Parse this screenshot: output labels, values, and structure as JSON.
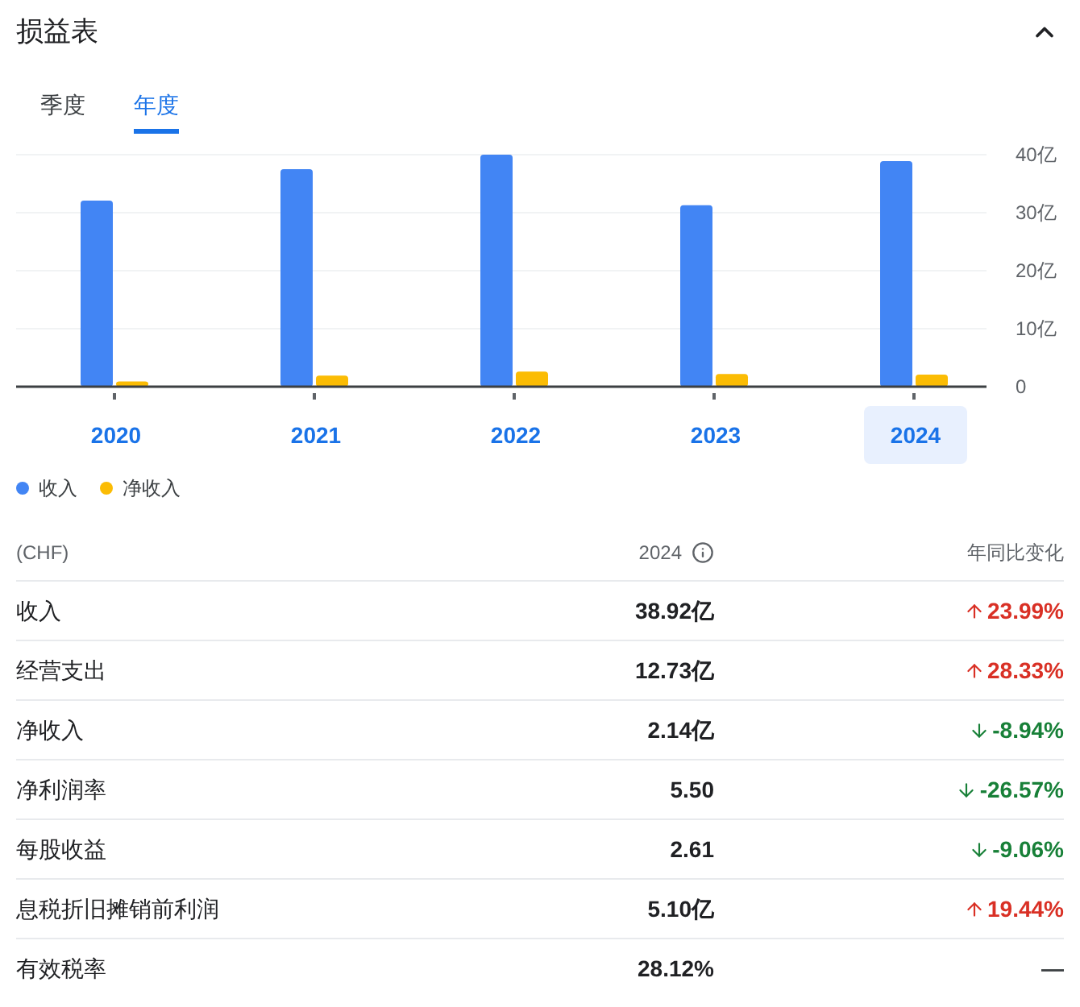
{
  "title": "损益表",
  "period_tabs": [
    {
      "label": "季度",
      "selected": false
    },
    {
      "label": "年度",
      "selected": true
    }
  ],
  "chart_data": {
    "type": "bar",
    "categories": [
      "2020",
      "2021",
      "2022",
      "2023",
      "2024"
    ],
    "series": [
      {
        "name": "收入",
        "color": "#4285f4",
        "values": [
          32.1,
          37.5,
          40,
          31.3,
          38.9
        ]
      },
      {
        "name": "净收入",
        "color": "#fbbc04",
        "values": [
          0.9,
          1.9,
          2.6,
          2.2,
          2.1
        ]
      }
    ],
    "ylim": [
      0,
      40
    ],
    "grid": true,
    "yticks": [
      {
        "value": 0,
        "label": "0"
      },
      {
        "value": 10,
        "label": "10亿"
      },
      {
        "value": 20,
        "label": "20亿"
      },
      {
        "value": 30,
        "label": "30亿"
      },
      {
        "value": 40,
        "label": "40亿"
      }
    ]
  },
  "year_tabs": [
    {
      "selected": false
    },
    {
      "selected": false
    },
    {
      "selected": false
    },
    {
      "selected": false
    },
    {
      "selected": true
    }
  ],
  "table": {
    "columns": [
      "(CHF)",
      "2024",
      "年同比变化"
    ],
    "rows": [
      {
        "label": "收入",
        "value": "38.92亿",
        "change": "23.99%",
        "kind": "up"
      },
      {
        "label": "经营支出",
        "value": "12.73亿",
        "change": "28.33%",
        "kind": "up"
      },
      {
        "label": "净收入",
        "value": "2.14亿",
        "change": "-8.94%",
        "kind": "down"
      },
      {
        "label": "净利润率",
        "value": "5.50",
        "change": "-26.57%",
        "kind": "down"
      },
      {
        "label": "每股收益",
        "value": "2.61",
        "change": "-9.06%",
        "kind": "down"
      },
      {
        "label": "息税折旧摊销前利润",
        "value": "5.10亿",
        "change": "19.44%",
        "kind": "up"
      },
      {
        "label": "有效税率",
        "value": "28.12%",
        "change": "—",
        "kind": "neutral"
      }
    ]
  }
}
